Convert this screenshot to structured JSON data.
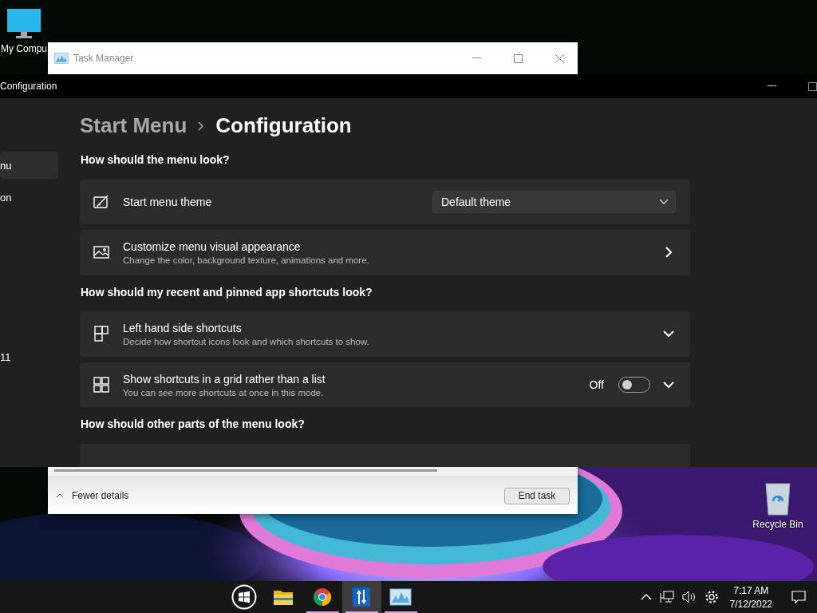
{
  "desktop_icons": [
    {
      "kind": "computer",
      "label": "My Compu"
    },
    {
      "kind": "bin",
      "label": "Recycle Bin"
    }
  ],
  "task_manager": {
    "title": "Task Manager",
    "details_toggle": "Fewer details",
    "end_task": "End task"
  },
  "config_window": {
    "title": "Configuration",
    "sidebar": [
      {
        "label": "nu",
        "selected": true
      },
      {
        "label": "on",
        "selected": false
      }
    ],
    "sidebar_lower": [
      {
        "label": "11",
        "selected": false
      }
    ],
    "breadcrumb": [
      "Start Menu",
      "Configuration"
    ],
    "sections": [
      {
        "heading": "How should the menu look?",
        "settings": [
          {
            "kind": "dropdown",
            "title": "Start menu theme",
            "value": "Default theme"
          },
          {
            "kind": "link",
            "title": "Customize menu visual appearance",
            "description": "Change the color, background texture, animations and more."
          }
        ]
      },
      {
        "heading": "How should my recent and pinned app shortcuts look?",
        "settings": [
          {
            "kind": "expander",
            "title": "Left hand side shortcuts",
            "description": "Decide how shortcut icons look and which shortcuts to show.",
            "expanded": false
          },
          {
            "kind": "toggle",
            "title": "Show shortcuts in a grid rather than a list",
            "description": "You can see more shortcuts at once in this mode.",
            "on": false,
            "state_label": "Off",
            "expanded": false
          }
        ]
      },
      {
        "heading": "How should other parts of the menu look?",
        "settings": [
          {
            "kind": "cut"
          }
        ]
      }
    ]
  },
  "taskbar": {
    "apps": [
      {
        "kind": "start",
        "running": false,
        "selected": false
      },
      {
        "kind": "folder",
        "running": false,
        "selected": false
      },
      {
        "kind": "browser",
        "running": true,
        "selected": false
      },
      {
        "kind": "app",
        "running": true,
        "selected": true
      },
      {
        "kind": "monitor",
        "running": true,
        "selected": false
      }
    ],
    "time": "7:17 AM",
    "date": "7/12/2022"
  }
}
